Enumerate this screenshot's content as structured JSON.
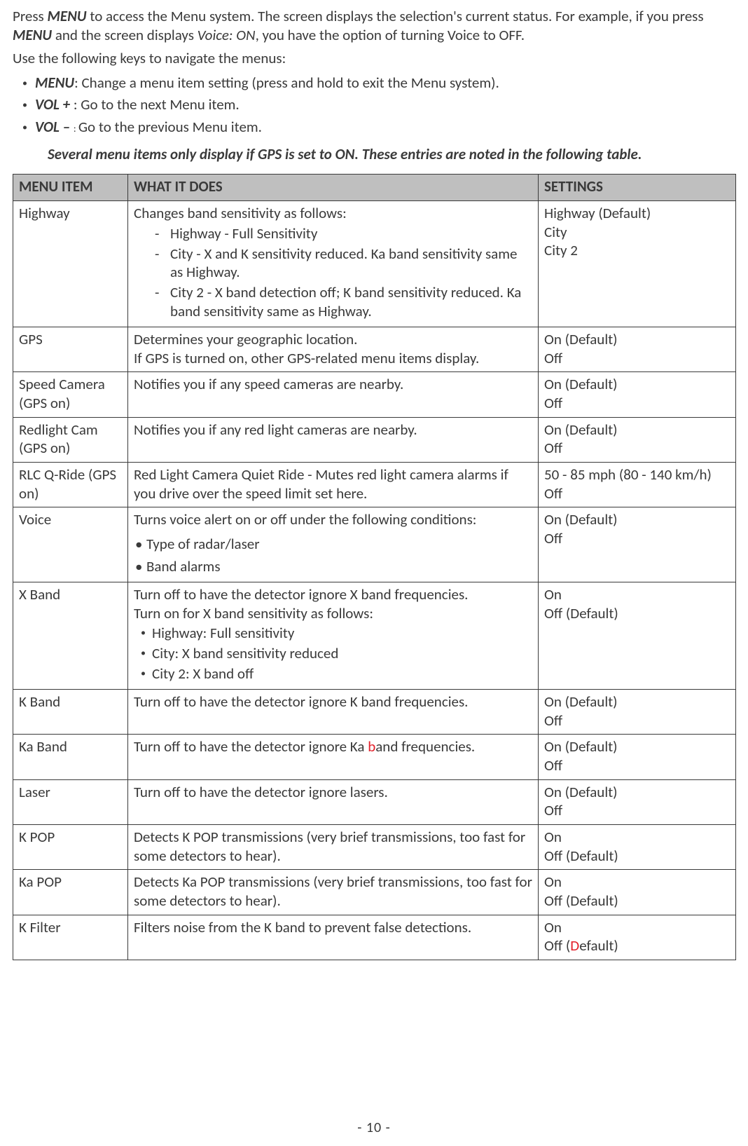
{
  "intro": {
    "p1a": "Press ",
    "p1b": "MENU",
    "p1c": " to access the Menu system. The screen displays the selection's current status. For example, if you press ",
    "p1d": "MENU",
    "p1e": " and the screen displays ",
    "p1f": "Voice: ON",
    "p1g": ", you have the option of turning Voice to OFF.",
    "p2": "Use the following keys to navigate the menus:"
  },
  "nav": [
    {
      "key": "MENU",
      "sep": ": ",
      "desc": "Change a menu item setting (press and hold to exit the Menu system)."
    },
    {
      "key": "VOL + ",
      "sep": ": ",
      "desc": "Go to the next Menu item."
    },
    {
      "key": "VOL – ",
      "sep": ": ",
      "desc": "Go to the previous Menu item."
    }
  ],
  "note": "Several menu items only display if GPS is set to ON. These entries are noted in the following table.",
  "table": {
    "headers": [
      "MENU ITEM",
      "WHAT IT DOES",
      "SETTINGS"
    ],
    "rows": [
      {
        "item": "Highway",
        "desc": {
          "intro": "Changes band sensitivity as follows:",
          "type": "dash",
          "items": [
            "Highway - Full Sensitivity",
            "City - X and K sensitivity reduced. Ka band sensitivity same as Highway.",
            "City 2 - X band detection off; K band sensitivity reduced. Ka band sensitivity same as Highway."
          ]
        },
        "settings": [
          "Highway (Default)",
          "City",
          "City 2"
        ]
      },
      {
        "item": "GPS",
        "desc": {
          "lines": [
            "Determines your geographic location.",
            "If GPS is turned on, other GPS-related menu items display."
          ]
        },
        "settings": [
          "On (Default)",
          "Off"
        ]
      },
      {
        "item": "Speed Camera (GPS on)",
        "desc": {
          "lines": [
            "Notifies you if any speed cameras are nearby."
          ]
        },
        "settings": [
          "On (Default)",
          "Off"
        ]
      },
      {
        "item": "Redlight Cam (GPS on)",
        "desc": {
          "lines": [
            "Notifies you if any red light cameras are nearby."
          ]
        },
        "settings": [
          "On (Default)",
          "Off"
        ]
      },
      {
        "item": "RLC Q-Ride (GPS on)",
        "desc": {
          "lines": [
            "Red Light Camera Quiet Ride - Mutes red light camera alarms if you drive over the speed limit set here."
          ]
        },
        "settings": [
          "50 - 85 mph (80 - 140 km/h)",
          "Off"
        ]
      },
      {
        "item": "Voice",
        "desc": {
          "intro": "Turns voice alert on or off under the following conditions:",
          "type": "bul",
          "items": [
            "Type of radar/laser",
            "Band alarms"
          ]
        },
        "settings": [
          "On (Default)",
          "Off"
        ]
      },
      {
        "item": "X Band",
        "desc": {
          "lines": [
            "Turn off to have the detector ignore X band frequencies.",
            "Turn on for X band sensitivity as follows:"
          ],
          "type": "dot",
          "items": [
            "Highway: Full sensitivity",
            "City: X band sensitivity reduced",
            "City 2: X band off"
          ]
        },
        "settings": [
          "On",
          "Off (Default)"
        ]
      },
      {
        "item": "K Band",
        "desc": {
          "lines": [
            "Turn off to have the detector ignore K band frequencies."
          ]
        },
        "settings": [
          "On (Default)",
          "Off"
        ]
      },
      {
        "item": "Ka Band",
        "desc": {
          "rich": [
            {
              "t": "Turn off to have the detector ignore Ka "
            },
            {
              "t": "b",
              "red": true
            },
            {
              "t": "and frequencies."
            }
          ]
        },
        "settings": [
          "On (Default)",
          "Off"
        ]
      },
      {
        "item": "Laser",
        "desc": {
          "lines": [
            "Turn off to have the detector ignore lasers."
          ]
        },
        "settings": [
          "On (Default)",
          "Off"
        ]
      },
      {
        "item": "K POP",
        "desc": {
          "lines": [
            "Detects K POP transmissions (very brief transmissions, too fast for some detectors to hear)."
          ]
        },
        "settings": [
          "On",
          "Off (Default)"
        ]
      },
      {
        "item": "Ka POP",
        "desc": {
          "lines": [
            "Detects Ka POP transmissions (very brief transmissions, too fast for some detectors to hear)."
          ]
        },
        "settings": [
          "On",
          "Off (Default)"
        ]
      },
      {
        "item": "K Filter",
        "desc": {
          "lines": [
            "Filters noise from the K band to prevent false detections."
          ]
        },
        "settings_rich": [
          [
            {
              "t": "On"
            }
          ],
          [
            {
              "t": "Off ("
            },
            {
              "t": "D",
              "red": true
            },
            {
              "t": "efault)"
            }
          ]
        ]
      }
    ]
  },
  "page_number": "- 10 -"
}
